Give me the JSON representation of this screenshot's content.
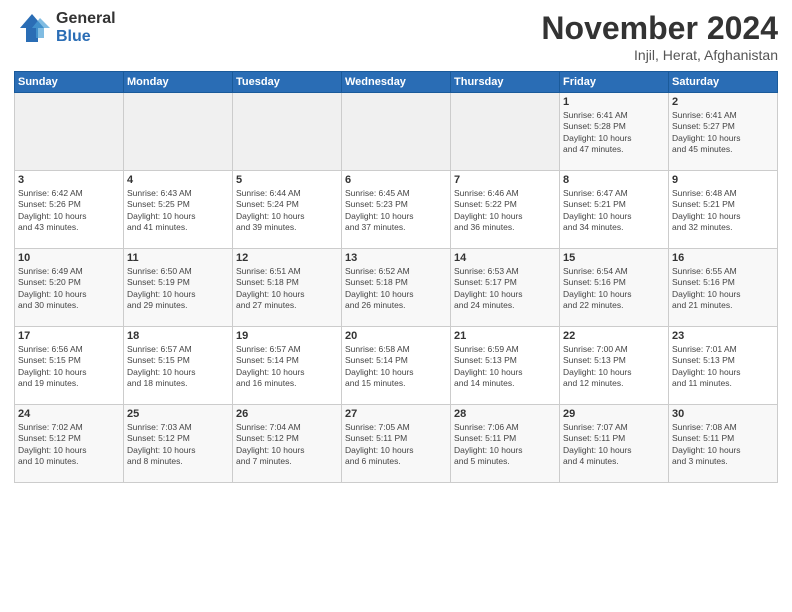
{
  "logo": {
    "general": "General",
    "blue": "Blue"
  },
  "title": "November 2024",
  "location": "Injil, Herat, Afghanistan",
  "days_header": [
    "Sunday",
    "Monday",
    "Tuesday",
    "Wednesday",
    "Thursday",
    "Friday",
    "Saturday"
  ],
  "weeks": [
    [
      {
        "num": "",
        "info": ""
      },
      {
        "num": "",
        "info": ""
      },
      {
        "num": "",
        "info": ""
      },
      {
        "num": "",
        "info": ""
      },
      {
        "num": "",
        "info": ""
      },
      {
        "num": "1",
        "info": "Sunrise: 6:41 AM\nSunset: 5:28 PM\nDaylight: 10 hours\nand 47 minutes."
      },
      {
        "num": "2",
        "info": "Sunrise: 6:41 AM\nSunset: 5:27 PM\nDaylight: 10 hours\nand 45 minutes."
      }
    ],
    [
      {
        "num": "3",
        "info": "Sunrise: 6:42 AM\nSunset: 5:26 PM\nDaylight: 10 hours\nand 43 minutes."
      },
      {
        "num": "4",
        "info": "Sunrise: 6:43 AM\nSunset: 5:25 PM\nDaylight: 10 hours\nand 41 minutes."
      },
      {
        "num": "5",
        "info": "Sunrise: 6:44 AM\nSunset: 5:24 PM\nDaylight: 10 hours\nand 39 minutes."
      },
      {
        "num": "6",
        "info": "Sunrise: 6:45 AM\nSunset: 5:23 PM\nDaylight: 10 hours\nand 37 minutes."
      },
      {
        "num": "7",
        "info": "Sunrise: 6:46 AM\nSunset: 5:22 PM\nDaylight: 10 hours\nand 36 minutes."
      },
      {
        "num": "8",
        "info": "Sunrise: 6:47 AM\nSunset: 5:21 PM\nDaylight: 10 hours\nand 34 minutes."
      },
      {
        "num": "9",
        "info": "Sunrise: 6:48 AM\nSunset: 5:21 PM\nDaylight: 10 hours\nand 32 minutes."
      }
    ],
    [
      {
        "num": "10",
        "info": "Sunrise: 6:49 AM\nSunset: 5:20 PM\nDaylight: 10 hours\nand 30 minutes."
      },
      {
        "num": "11",
        "info": "Sunrise: 6:50 AM\nSunset: 5:19 PM\nDaylight: 10 hours\nand 29 minutes."
      },
      {
        "num": "12",
        "info": "Sunrise: 6:51 AM\nSunset: 5:18 PM\nDaylight: 10 hours\nand 27 minutes."
      },
      {
        "num": "13",
        "info": "Sunrise: 6:52 AM\nSunset: 5:18 PM\nDaylight: 10 hours\nand 26 minutes."
      },
      {
        "num": "14",
        "info": "Sunrise: 6:53 AM\nSunset: 5:17 PM\nDaylight: 10 hours\nand 24 minutes."
      },
      {
        "num": "15",
        "info": "Sunrise: 6:54 AM\nSunset: 5:16 PM\nDaylight: 10 hours\nand 22 minutes."
      },
      {
        "num": "16",
        "info": "Sunrise: 6:55 AM\nSunset: 5:16 PM\nDaylight: 10 hours\nand 21 minutes."
      }
    ],
    [
      {
        "num": "17",
        "info": "Sunrise: 6:56 AM\nSunset: 5:15 PM\nDaylight: 10 hours\nand 19 minutes."
      },
      {
        "num": "18",
        "info": "Sunrise: 6:57 AM\nSunset: 5:15 PM\nDaylight: 10 hours\nand 18 minutes."
      },
      {
        "num": "19",
        "info": "Sunrise: 6:57 AM\nSunset: 5:14 PM\nDaylight: 10 hours\nand 16 minutes."
      },
      {
        "num": "20",
        "info": "Sunrise: 6:58 AM\nSunset: 5:14 PM\nDaylight: 10 hours\nand 15 minutes."
      },
      {
        "num": "21",
        "info": "Sunrise: 6:59 AM\nSunset: 5:13 PM\nDaylight: 10 hours\nand 14 minutes."
      },
      {
        "num": "22",
        "info": "Sunrise: 7:00 AM\nSunset: 5:13 PM\nDaylight: 10 hours\nand 12 minutes."
      },
      {
        "num": "23",
        "info": "Sunrise: 7:01 AM\nSunset: 5:13 PM\nDaylight: 10 hours\nand 11 minutes."
      }
    ],
    [
      {
        "num": "24",
        "info": "Sunrise: 7:02 AM\nSunset: 5:12 PM\nDaylight: 10 hours\nand 10 minutes."
      },
      {
        "num": "25",
        "info": "Sunrise: 7:03 AM\nSunset: 5:12 PM\nDaylight: 10 hours\nand 8 minutes."
      },
      {
        "num": "26",
        "info": "Sunrise: 7:04 AM\nSunset: 5:12 PM\nDaylight: 10 hours\nand 7 minutes."
      },
      {
        "num": "27",
        "info": "Sunrise: 7:05 AM\nSunset: 5:11 PM\nDaylight: 10 hours\nand 6 minutes."
      },
      {
        "num": "28",
        "info": "Sunrise: 7:06 AM\nSunset: 5:11 PM\nDaylight: 10 hours\nand 5 minutes."
      },
      {
        "num": "29",
        "info": "Sunrise: 7:07 AM\nSunset: 5:11 PM\nDaylight: 10 hours\nand 4 minutes."
      },
      {
        "num": "30",
        "info": "Sunrise: 7:08 AM\nSunset: 5:11 PM\nDaylight: 10 hours\nand 3 minutes."
      }
    ]
  ]
}
